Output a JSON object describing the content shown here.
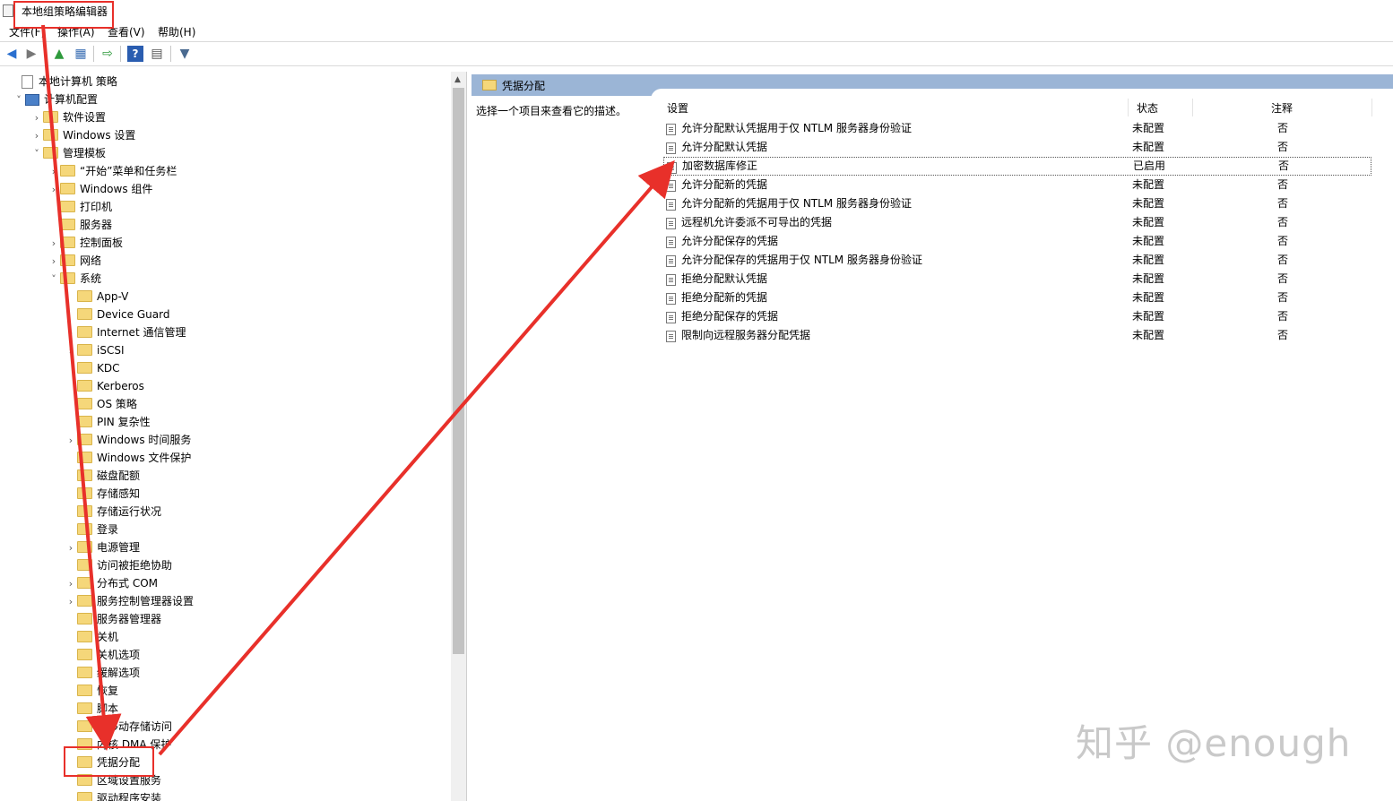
{
  "window": {
    "title": "本地组策略编辑器"
  },
  "menu": [
    "文件(F)",
    "操作(A)",
    "查看(V)",
    "帮助(H)"
  ],
  "toolbar": [
    "back-icon",
    "forward-icon",
    "up-folder-icon",
    "show-hide-tree-icon",
    "export-list-icon",
    "help-icon",
    "properties-icon",
    "filter-icon"
  ],
  "tree": [
    {
      "label": "本地计算机 策略",
      "level": 0,
      "expander": "",
      "icon": "doc"
    },
    {
      "label": "计算机配置",
      "level": 1,
      "expander": "v",
      "icon": "computer"
    },
    {
      "label": "软件设置",
      "level": 2,
      "expander": ">",
      "icon": "folder"
    },
    {
      "label": "Windows 设置",
      "level": 2,
      "expander": ">",
      "icon": "folder"
    },
    {
      "label": "管理模板",
      "level": 2,
      "expander": "v",
      "icon": "folder"
    },
    {
      "label": "“开始”菜单和任务栏",
      "level": 3,
      "expander": ">",
      "icon": "folder"
    },
    {
      "label": "Windows 组件",
      "level": 3,
      "expander": ">",
      "icon": "folder"
    },
    {
      "label": "打印机",
      "level": 3,
      "expander": "",
      "icon": "folder"
    },
    {
      "label": "服务器",
      "level": 3,
      "expander": "",
      "icon": "folder"
    },
    {
      "label": "控制面板",
      "level": 3,
      "expander": ">",
      "icon": "folder"
    },
    {
      "label": "网络",
      "level": 3,
      "expander": ">",
      "icon": "folder"
    },
    {
      "label": "系统",
      "level": 3,
      "expander": "v",
      "icon": "folder"
    },
    {
      "label": "App-V",
      "level": 4,
      "expander": "",
      "icon": "folder"
    },
    {
      "label": "Device Guard",
      "level": 4,
      "expander": "",
      "icon": "folder"
    },
    {
      "label": "Internet 通信管理",
      "level": 4,
      "expander": ">",
      "icon": "folder"
    },
    {
      "label": "iSCSI",
      "level": 4,
      "expander": ">",
      "icon": "folder"
    },
    {
      "label": "KDC",
      "level": 4,
      "expander": "",
      "icon": "folder"
    },
    {
      "label": "Kerberos",
      "level": 4,
      "expander": "",
      "icon": "folder"
    },
    {
      "label": "OS 策略",
      "level": 4,
      "expander": "",
      "icon": "folder"
    },
    {
      "label": "PIN 复杂性",
      "level": 4,
      "expander": "",
      "icon": "folder"
    },
    {
      "label": "Windows 时间服务",
      "level": 4,
      "expander": ">",
      "icon": "folder"
    },
    {
      "label": "Windows 文件保护",
      "level": 4,
      "expander": "",
      "icon": "folder"
    },
    {
      "label": "磁盘配额",
      "level": 4,
      "expander": "",
      "icon": "folder"
    },
    {
      "label": "存储感知",
      "level": 4,
      "expander": "",
      "icon": "folder"
    },
    {
      "label": "存储运行状况",
      "level": 4,
      "expander": "",
      "icon": "folder"
    },
    {
      "label": "登录",
      "level": 4,
      "expander": "",
      "icon": "folder"
    },
    {
      "label": "电源管理",
      "level": 4,
      "expander": ">",
      "icon": "folder"
    },
    {
      "label": "访问被拒绝协助",
      "level": 4,
      "expander": "",
      "icon": "folder"
    },
    {
      "label": "分布式 COM",
      "level": 4,
      "expander": ">",
      "icon": "folder"
    },
    {
      "label": "服务控制管理器设置",
      "level": 4,
      "expander": ">",
      "icon": "folder"
    },
    {
      "label": "服务器管理器",
      "level": 4,
      "expander": "",
      "icon": "folder"
    },
    {
      "label": "关机",
      "level": 4,
      "expander": "",
      "icon": "folder"
    },
    {
      "label": "关机选项",
      "level": 4,
      "expander": "",
      "icon": "folder"
    },
    {
      "label": "缓解选项",
      "level": 4,
      "expander": "",
      "icon": "folder"
    },
    {
      "label": "恢复",
      "level": 4,
      "expander": "",
      "icon": "folder"
    },
    {
      "label": "脚本",
      "level": 4,
      "expander": "",
      "icon": "folder"
    },
    {
      "label": "可移动存储访问",
      "level": 4,
      "expander": "",
      "icon": "folder"
    },
    {
      "label": "内核 DMA 保护",
      "level": 4,
      "expander": "",
      "icon": "folder"
    },
    {
      "label": "凭据分配",
      "level": 4,
      "expander": "",
      "icon": "folder"
    },
    {
      "label": "区域设置服务",
      "level": 4,
      "expander": "",
      "icon": "folder"
    },
    {
      "label": "驱动程序安装",
      "level": 4,
      "expander": "",
      "icon": "folder"
    }
  ],
  "right": {
    "header": "凭据分配",
    "description": "选择一个项目来查看它的描述。",
    "columns": [
      "设置",
      "状态",
      "注释"
    ],
    "rows": [
      {
        "name": "允许分配默认凭据用于仅 NTLM 服务器身份验证",
        "state": "未配置",
        "note": "否"
      },
      {
        "name": "允许分配默认凭据",
        "state": "未配置",
        "note": "否"
      },
      {
        "name": "加密数据库修正",
        "state": "已启用",
        "note": "否"
      },
      {
        "name": "允许分配新的凭据",
        "state": "未配置",
        "note": "否"
      },
      {
        "name": "允许分配新的凭据用于仅 NTLM 服务器身份验证",
        "state": "未配置",
        "note": "否"
      },
      {
        "name": "远程机允许委派不可导出的凭据",
        "state": "未配置",
        "note": "否"
      },
      {
        "name": "允许分配保存的凭据",
        "state": "未配置",
        "note": "否"
      },
      {
        "name": "允许分配保存的凭据用于仅 NTLM 服务器身份验证",
        "state": "未配置",
        "note": "否"
      },
      {
        "name": "拒绝分配默认凭据",
        "state": "未配置",
        "note": "否"
      },
      {
        "name": "拒绝分配新的凭据",
        "state": "未配置",
        "note": "否"
      },
      {
        "name": "拒绝分配保存的凭据",
        "state": "未配置",
        "note": "否"
      },
      {
        "name": "限制向远程服务器分配凭据",
        "state": "未配置",
        "note": "否"
      }
    ]
  },
  "watermark": "知乎 @enough",
  "colors": {
    "annotation": "#e8302a",
    "header_bar": "#9bb5d6",
    "folder": "#f5d77a"
  }
}
